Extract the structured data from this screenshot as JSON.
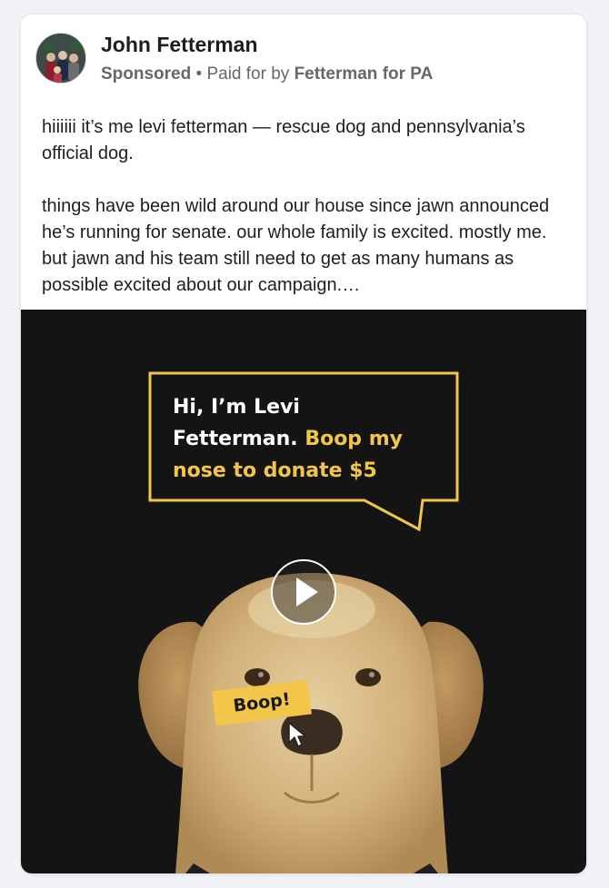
{
  "post": {
    "author": "John Fetterman",
    "sponsored_label": "Sponsored",
    "separator": " • ",
    "paid_for_prefix": "Paid for by ",
    "paid_for_name": "Fetterman for PA",
    "body_paragraph_1": "hiiiiii it’s me levi fetterman — rescue dog and pennsylvania’s official dog.",
    "body_paragraph_2": "things have been wild around our house since jawn announced he’s running for senate. our whole family is excited. mostly me. but jawn and his team still need to get as many humans as possible excited about our campaign.…"
  },
  "video": {
    "speech_white_1": "Hi, I’m Levi",
    "speech_white_2": "Fetterman. ",
    "speech_yellow_1": "Boop my",
    "speech_yellow_2": "nose to donate $5",
    "nose_tag": "Boop!",
    "accent_color": "#f2c64b",
    "background_color": "#141414",
    "play_icon": "play-icon"
  }
}
